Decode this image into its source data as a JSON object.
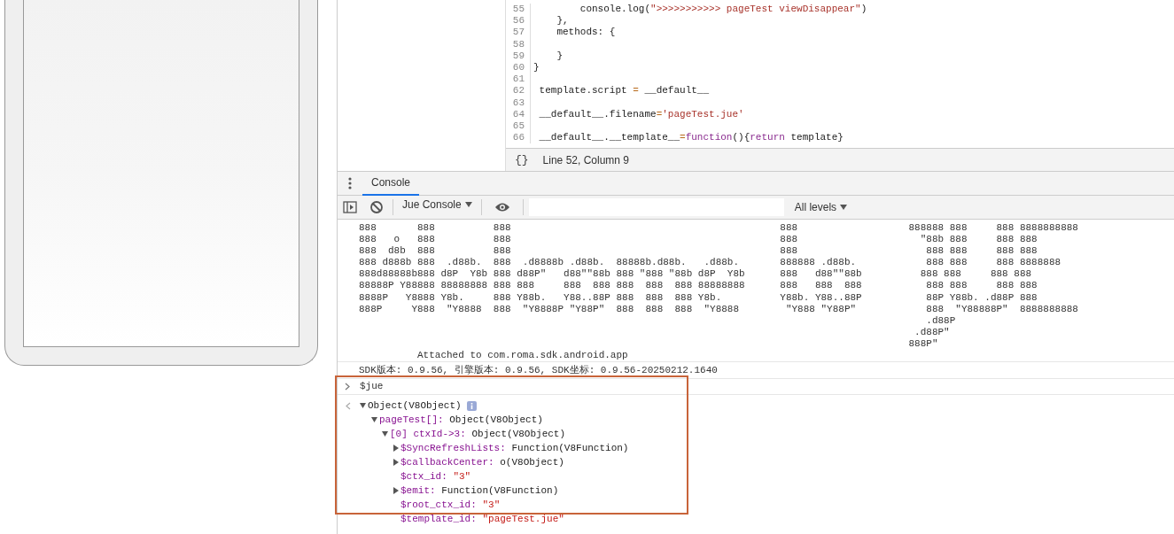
{
  "editor": {
    "lines": [
      {
        "number": "55",
        "tokens": [
          {
            "text": "        console.log(",
            "kind": "plain"
          },
          {
            "text": "\">>>>>>>>>>> pageTest viewDisappear\"",
            "kind": "string"
          },
          {
            "text": ")",
            "kind": "plain"
          }
        ]
      },
      {
        "number": "56",
        "tokens": [
          {
            "text": "    },",
            "kind": "plain"
          }
        ]
      },
      {
        "number": "57",
        "tokens": [
          {
            "text": "    methods: {",
            "kind": "plain"
          }
        ]
      },
      {
        "number": "58"
      },
      {
        "number": "59",
        "tokens": [
          {
            "text": "    }",
            "kind": "plain"
          }
        ]
      },
      {
        "number": "60",
        "tokens": [
          {
            "text": "}",
            "kind": "plain"
          }
        ]
      },
      {
        "number": "61"
      },
      {
        "number": "62",
        "tokens": [
          {
            "text": " template.script ",
            "kind": "plain"
          },
          {
            "text": "=",
            "kind": "operator"
          },
          {
            "text": " __default__",
            "kind": "plain"
          }
        ]
      },
      {
        "number": "63"
      },
      {
        "number": "64",
        "tokens": [
          {
            "text": " __default__.filename",
            "kind": "plain"
          },
          {
            "text": "=",
            "kind": "operator"
          },
          {
            "text": "'pageTest.jue'",
            "kind": "string"
          }
        ]
      },
      {
        "number": "65"
      },
      {
        "number": "66",
        "tokens": [
          {
            "text": " __default__.__template__",
            "kind": "plain"
          },
          {
            "text": "=",
            "kind": "operator"
          },
          {
            "text": "function",
            "kind": "keyword"
          },
          {
            "text": "(){",
            "kind": "plain"
          },
          {
            "text": "return",
            "kind": "keyword"
          },
          {
            "text": " template}",
            "kind": "plain"
          }
        ]
      }
    ],
    "status": {
      "format_button": "{}",
      "position": "Line 52, Column 9"
    }
  },
  "drawer": {
    "tabs": [
      {
        "label": "Console",
        "selected": true
      }
    ]
  },
  "toolbar": {
    "context": "Jue Console",
    "levels": "All levels"
  },
  "console": {
    "banner_lines": [
      "888       888          888                                              888                   888888 888     888 8888888888",
      "888   o   888          888                                              888                     \"88b 888     888 888",
      "888  d8b  888          888                                              888                      888 888     888 888",
      "888 d888b 888  .d88b.  888  .d8888b .d88b.  88888b.d88b.   .d88b.       888888 .d88b.            888 888     888 8888888",
      "888d88888b888 d8P  Y8b 888 d88P\"   d88\"\"88b 888 \"888 \"88b d8P  Y8b      888   d88\"\"88b          888 888     888 888",
      "88888P Y88888 88888888 888 888     888  888 888  888  888 88888888      888   888  888           888 888     888 888",
      "8888P   Y8888 Y8b.     888 Y88b.   Y88..88P 888  888  888 Y8b.          Y88b. Y88..88P           88P Y88b. .d88P 888",
      "888P     Y888  \"Y8888  888  \"Y8888P \"Y88P\"  888  888  888  \"Y8888        \"Y888 \"Y88P\"            888  \"Y88888P\"  8888888888",
      "                                                                                                 .d88P",
      "                                                                                               .d88P\"",
      "                                                                                              888P\""
    ],
    "attached": "Attached to com.roma.sdk.android.app",
    "sdk_info": "SDK版本: 0.9.56, 引擎版本: 0.9.56, SDK坐标: 0.9.56-20250212.1640",
    "input": "$jue",
    "result": {
      "kind": "node",
      "expanded": true,
      "value": "Object(V8Object)",
      "info": true,
      "children": [
        {
          "kind": "node",
          "expanded": true,
          "key": "pageTest[]:",
          "value": "Object(V8Object)",
          "children": [
            {
              "kind": "node",
              "expanded": true,
              "key": "[0] ctxId->3:",
              "value": "Object(V8Object)",
              "children": [
                {
                  "kind": "node",
                  "expanded": false,
                  "key": "$SyncRefreshLists:",
                  "value": "Function(V8Function)"
                },
                {
                  "kind": "node",
                  "expanded": false,
                  "key": "$callbackCenter:",
                  "value": "o(V8Object)"
                },
                {
                  "kind": "leaf",
                  "key": "$ctx_id:",
                  "value": "\"3\""
                },
                {
                  "kind": "node",
                  "expanded": false,
                  "key": "$emit:",
                  "value": "Function(V8Function)"
                },
                {
                  "kind": "leaf",
                  "key": "$root_ctx_id:",
                  "value": "\"3\""
                },
                {
                  "kind": "leaf",
                  "key": "$template_id:",
                  "value": "\"pageTest.jue\""
                }
              ]
            }
          ]
        }
      ]
    }
  }
}
